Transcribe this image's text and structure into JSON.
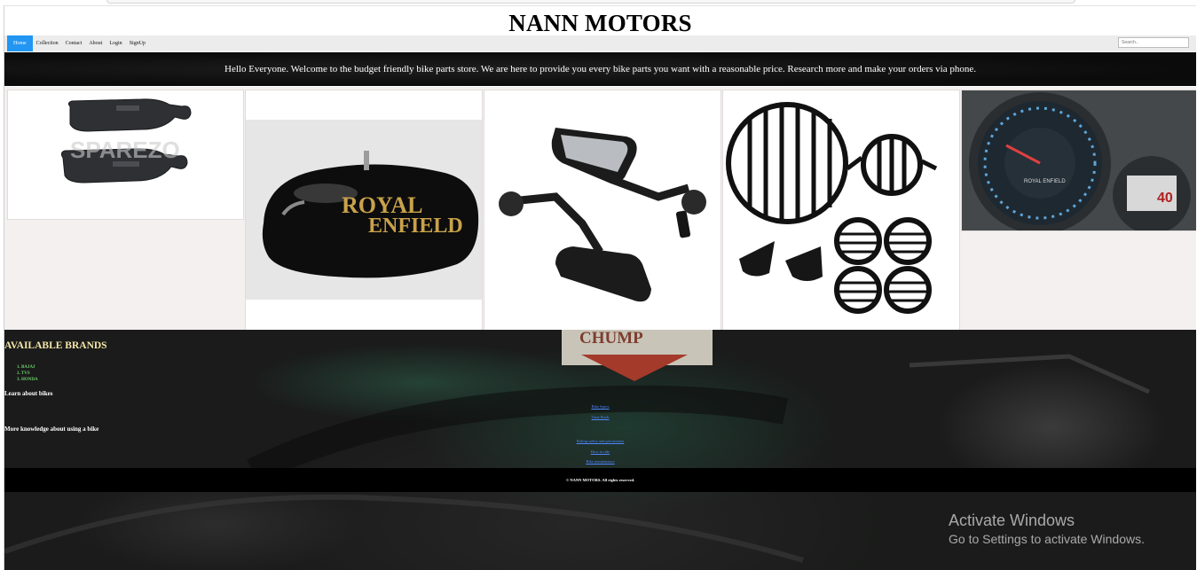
{
  "site": {
    "title": "NANN MOTORS"
  },
  "nav": {
    "items": [
      {
        "label": "Home",
        "active": true
      },
      {
        "label": "Collection"
      },
      {
        "label": "Contact"
      },
      {
        "label": "About"
      },
      {
        "label": "Login"
      },
      {
        "label": "SignUp"
      }
    ],
    "search_placeholder": "Search.."
  },
  "banner": {
    "text": "Hello Everyone. Welcome to the budget friendly bike parts store. We are here to provide you every bike parts you want with a reasonable price. Research more and make your orders via phone."
  },
  "gallery": {
    "items": [
      {
        "image": "brake-pads",
        "watermark": "SPAREZO"
      },
      {
        "image": "fuel-tank",
        "label_line1": "ROYAL",
        "label_line2": "ENFIELD"
      },
      {
        "image": "mirrors"
      },
      {
        "image": "headlight-grills"
      },
      {
        "image": "speedometer",
        "dial_brand": "ROYAL ENFIELD",
        "digital_reading": "40"
      }
    ]
  },
  "brands": {
    "title": "AVAILABLE BRANDS",
    "list": [
      "BAJAJ",
      "TVS",
      "HONDA"
    ]
  },
  "learn": {
    "title": "Learn about bikes",
    "links": [
      "Bike Specs",
      "Tune Book"
    ]
  },
  "knowledge": {
    "title": "More knowledge about using a bike",
    "links": [
      "Riding safety and precautions",
      "How to ride",
      "Bike maintenance"
    ]
  },
  "footer": {
    "text": "© NANN MOTORS. All rights reserved."
  },
  "background_sign": "CHUMP",
  "os_overlay": {
    "title": "Activate Windows",
    "subtitle": "Go to Settings to activate Windows."
  },
  "colors": {
    "nav_active": "#2196f3",
    "brands_title": "#f5e6a8",
    "brand_items": "#6fd36f",
    "links": "#4f86ff"
  }
}
